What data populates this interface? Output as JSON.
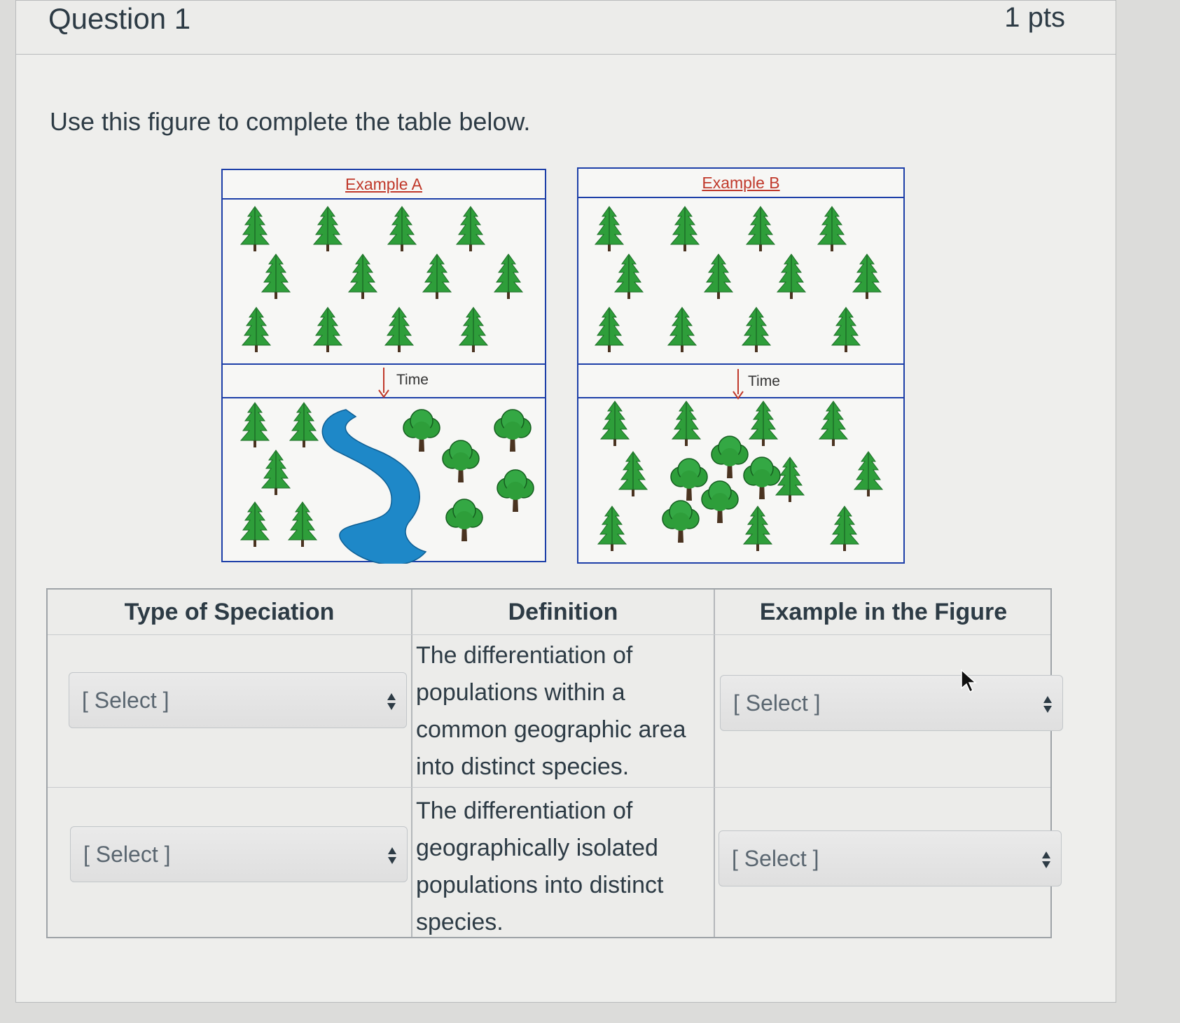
{
  "question": {
    "title": "Question 1",
    "points": "1 pts"
  },
  "prompt": "Use this figure to complete the table below.",
  "figure": {
    "example_a": {
      "title": "Example A",
      "time_label": "Time"
    },
    "example_b": {
      "title": "Example B",
      "time_label": "Time"
    }
  },
  "table": {
    "headers": [
      "Type of Speciation",
      "Definition",
      "Example in the Figure"
    ],
    "rows": [
      {
        "type_select": "[ Select ]",
        "definition": "The differentiation of populations within a common geographic area into distinct species.",
        "example_select": "[ Select ]"
      },
      {
        "type_select": "[ Select ]",
        "definition": "The differentiation of geographically isolated populations into distinct species.",
        "example_select": "[ Select ]"
      }
    ]
  },
  "colors": {
    "accent_border": "#1d3fa8",
    "title_red": "#c0392b",
    "tree_green": "#2e9e3a",
    "river_blue": "#1e88c8"
  },
  "icons": [
    "pine-tree-icon",
    "deciduous-tree-icon",
    "down-arrow-icon",
    "select-arrows-icon",
    "mouse-cursor-icon"
  ]
}
